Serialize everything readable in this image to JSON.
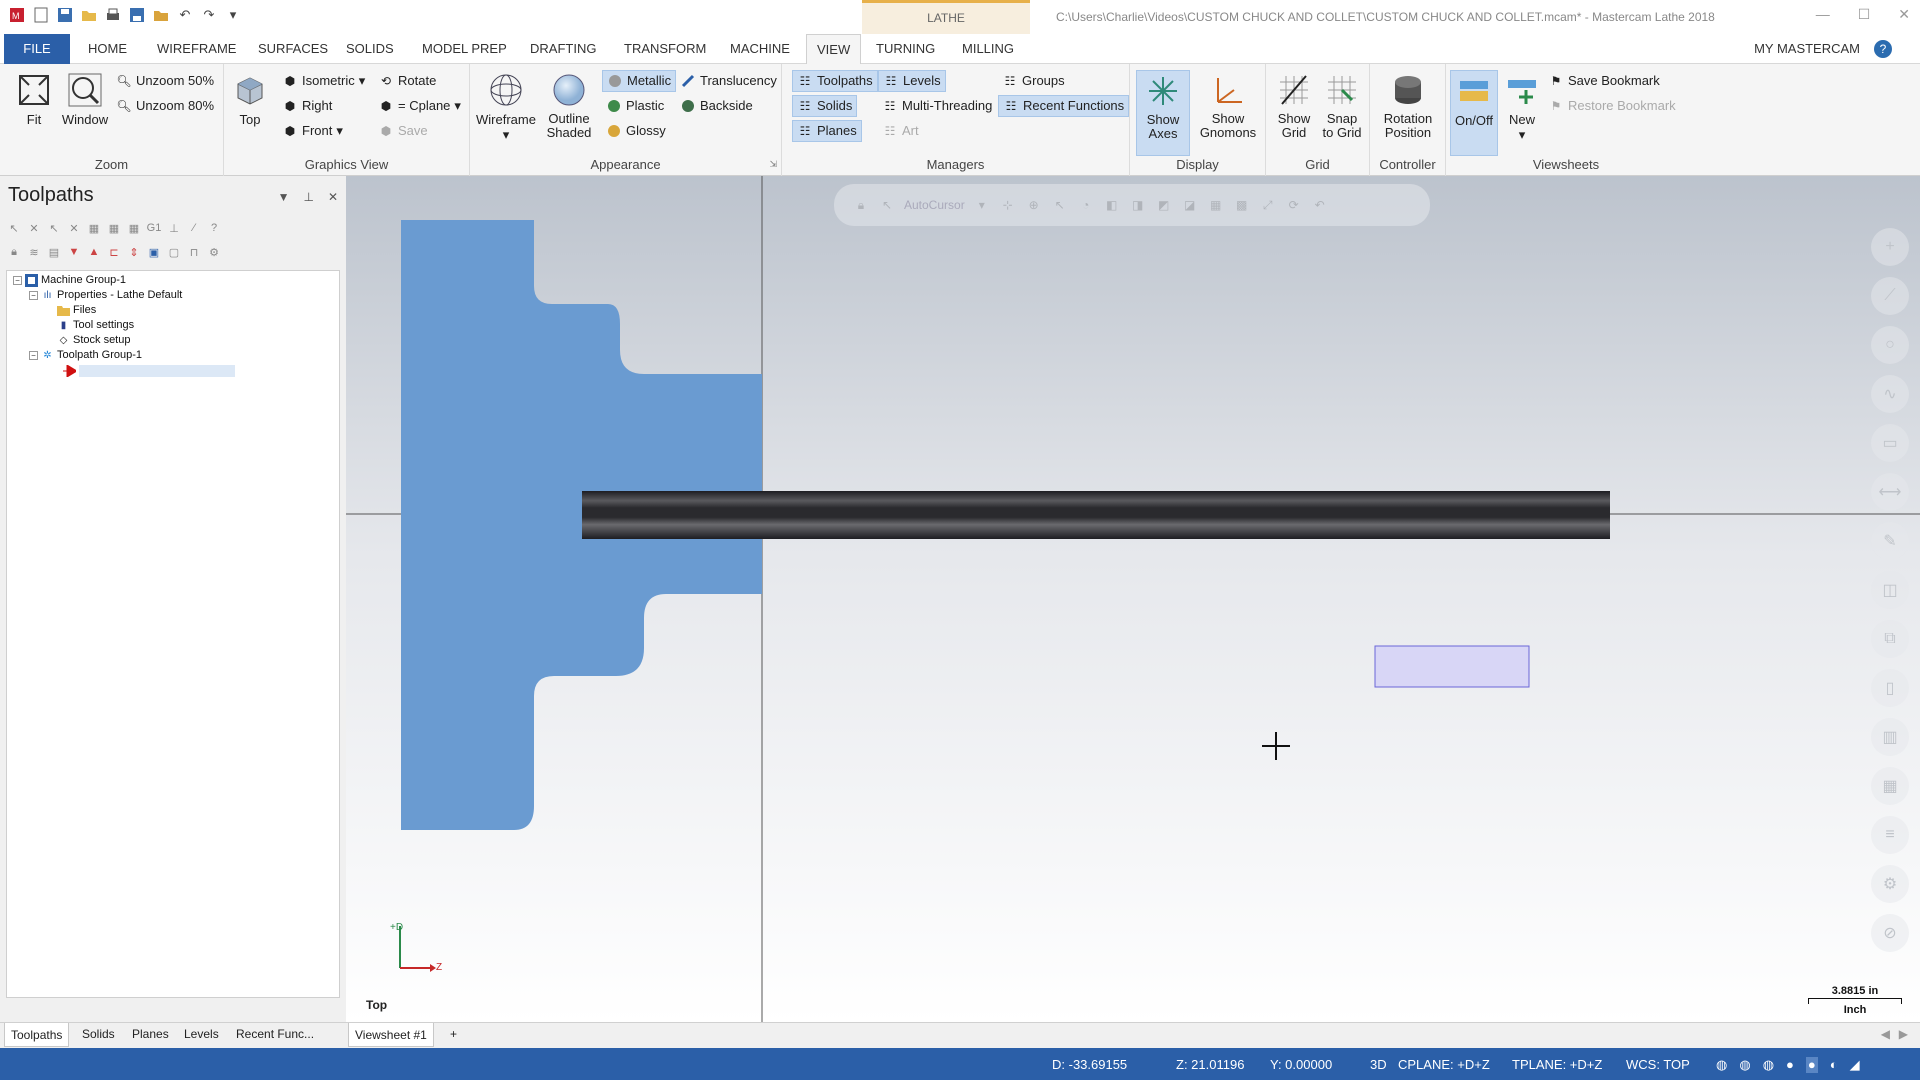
{
  "qat": {
    "icons": [
      "mastercam-logo-icon",
      "new-file-icon",
      "save-icon",
      "open-icon",
      "print-icon",
      "save-as-icon",
      "merge-icon",
      "undo-icon",
      "redo-icon",
      "customize-icon"
    ]
  },
  "window": {
    "context_tab": "LATHE",
    "title": "C:\\Users\\Charlie\\Videos\\CUSTOM CHUCK AND COLLET\\CUSTOM CHUCK AND COLLET.mcam* - Mastercam Lathe 2018"
  },
  "tabs": [
    "FILE",
    "HOME",
    "WIREFRAME",
    "SURFACES",
    "SOLIDS",
    "MODEL PREP",
    "DRAFTING",
    "TRANSFORM",
    "MACHINE",
    "VIEW",
    "TURNING",
    "MILLING"
  ],
  "active_tab": "VIEW",
  "my_mastercam": "MY MASTERCAM",
  "help": "?",
  "ribbon": {
    "zoom": {
      "label": "Zoom",
      "fit": "Fit",
      "window": "Window",
      "unzoom50": "Unzoom 50%",
      "unzoom80": "Unzoom 80%"
    },
    "graphics_view": {
      "label": "Graphics View",
      "top": "Top",
      "isometric": "Isometric",
      "right": "Right",
      "front": "Front",
      "rotate": "Rotate",
      "cplane": "= Cplane",
      "save": "Save"
    },
    "appearance": {
      "label": "Appearance",
      "wireframe": "Wireframe",
      "outline_shaded": "Outline Shaded",
      "metallic": "Metallic",
      "plastic": "Plastic",
      "glossy": "Glossy",
      "translucency": "Translucency",
      "backside": "Backside"
    },
    "managers": {
      "label": "Managers",
      "toolpaths": "Toolpaths",
      "solids": "Solids",
      "planes": "Planes",
      "levels": "Levels",
      "multi_threading": "Multi-Threading",
      "art": "Art",
      "groups": "Groups",
      "recent_functions": "Recent Functions"
    },
    "display": {
      "label": "Display",
      "show_axes": "Show Axes",
      "show_gnomons": "Show Gnomons"
    },
    "grid": {
      "label": "Grid",
      "show_grid": "Show Grid",
      "snap_to_grid": "Snap to Grid"
    },
    "controller": {
      "label": "Controller",
      "rotation_position": "Rotation Position"
    },
    "viewsheets": {
      "label": "Viewsheets",
      "on_off": "On/Off",
      "new": "New",
      "save_bookmark": "Save Bookmark",
      "restore_bookmark": "Restore Bookmark"
    }
  },
  "panel": {
    "title": "Toolpaths",
    "tree": {
      "machine_group": "Machine Group-1",
      "properties": "Properties - Lathe Default",
      "files": "Files",
      "tool_settings": "Tool settings",
      "stock_setup": "Stock setup",
      "toolpath_group": "Toolpath Group-1"
    }
  },
  "viewport": {
    "autocursor": "AutoCursor",
    "view_name": "Top",
    "gnomon_d": "+D",
    "gnomon_z": "Z",
    "scale_value": "3.8815 in",
    "scale_unit": "Inch"
  },
  "bottom_tabs": {
    "toolpaths": "Toolpaths",
    "solids": "Solids",
    "planes": "Planes",
    "levels": "Levels",
    "recent": "Recent Func...",
    "viewsheet": "Viewsheet #1",
    "add": "+"
  },
  "status": {
    "d": "D:  -33.69155",
    "z": "Z:  21.01196",
    "y": "Y:  0.00000",
    "mode": "3D",
    "cplane": "CPLANE: +D+Z",
    "tplane": "TPLANE: +D+Z",
    "wcs": "WCS: TOP"
  },
  "colors": {
    "accent": "#2b5fa8",
    "part": "#6a9bd1",
    "bar": "#2e2e33",
    "highlight": "#c9dcf2"
  }
}
